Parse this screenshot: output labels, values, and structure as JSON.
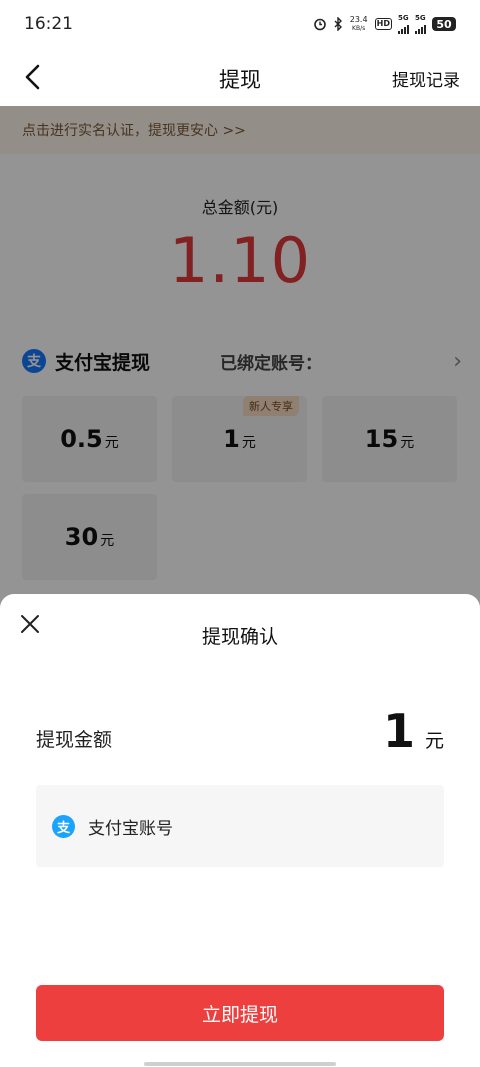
{
  "status_bar": {
    "time": "16:21",
    "speed_value": "23.4",
    "speed_unit": "KB/s",
    "hd_label": "HD",
    "signal1_label": "5G",
    "signal2_label": "5G",
    "battery": "50",
    "icons": [
      "alarm-icon",
      "bluetooth-icon",
      "hd-icon",
      "signal-icon",
      "signal-icon",
      "battery-icon"
    ]
  },
  "nav": {
    "title": "提现",
    "record_label": "提现记录",
    "back_icon": "back-arrow-icon"
  },
  "banner": {
    "text": "点击进行实名认证，提现更安心 >>"
  },
  "summary": {
    "label": "总金额(元)",
    "amount": "1.10",
    "amount_color": "#e03a3a"
  },
  "alipay": {
    "logo_char": "支",
    "title": "支付宝提现",
    "bound_label": "已绑定账号：",
    "arrow": "›"
  },
  "amount_options": [
    {
      "value": "0.5",
      "unit": "元",
      "tag": ""
    },
    {
      "value": "1",
      "unit": "元",
      "tag": "新人专享"
    },
    {
      "value": "15",
      "unit": "元",
      "tag": ""
    },
    {
      "value": "30",
      "unit": "元",
      "tag": ""
    }
  ],
  "sheet": {
    "title": "提现确认",
    "amount_label": "提现金额",
    "amount_value": "1",
    "amount_unit": "元",
    "account_logo_char": "支",
    "account_label": "支付宝账号",
    "confirm_label": "立即提现",
    "confirm_color": "#ee3f3f"
  }
}
